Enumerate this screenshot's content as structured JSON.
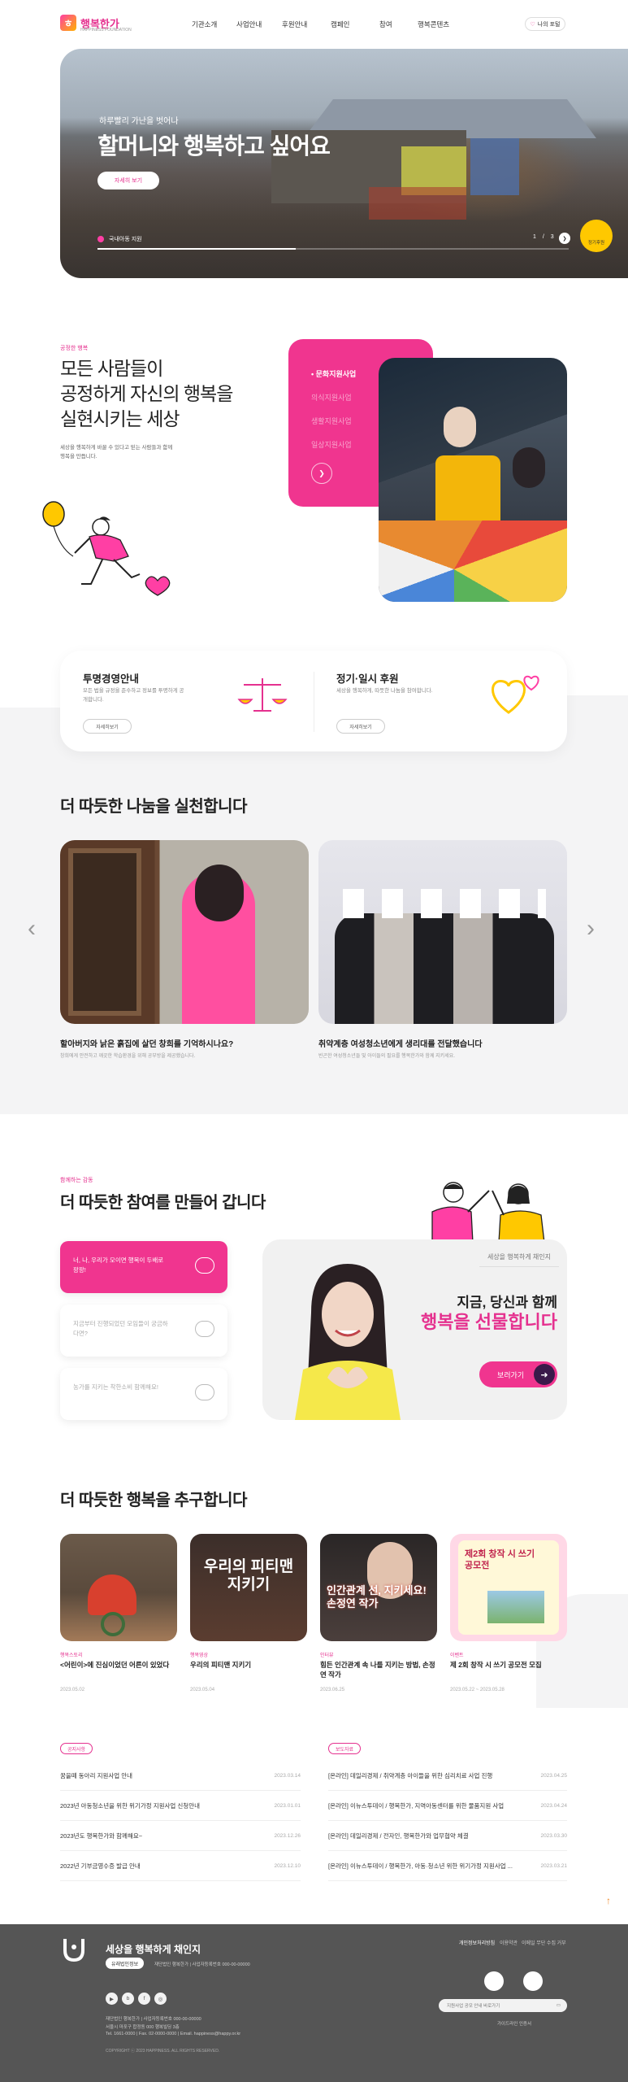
{
  "header": {
    "logo": "행복한가",
    "logo_sub": "HAPPINESS FOUNDATION",
    "nav": [
      "기관소개",
      "사업안내",
      "후원안내",
      "캠페인",
      "참여",
      "행복콘텐츠"
    ],
    "my": "나의 포털"
  },
  "hero": {
    "subtitle": "하루빨리 가난을 벗어나",
    "title": "할머니와 행복하고 싶어요",
    "button": "자세히 보기",
    "caption": "국내아동 지원",
    "pager": "1 / 3",
    "badge": "정기후원"
  },
  "mission": {
    "tag": "공정한 행복",
    "title_lines": [
      "모든 사람들이",
      "공정하게 자신의 행복을",
      "실현시키는 세상"
    ],
    "desc": "세상을 행복하게 바꿀 수 있다고 믿는 사람들과 함께 행복을 만듭니다.",
    "menu": [
      "문화지원사업",
      "의식지원사업",
      "생활지원사업",
      "일상지원사업"
    ]
  },
  "cards": [
    {
      "title": "투명경영안내",
      "desc": "모든 법을 규정을 준수하고 정보를 투명하게 공개합니다.",
      "btn": "자세히보기"
    },
    {
      "title": "정기·일시 후원",
      "desc": "세상을 행복하게, 따뜻한 나눔을 참여합니다.",
      "btn": "자세히보기"
    }
  ],
  "sharing": {
    "title": "더 따듯한 나눔을 실천합니다",
    "items": [
      {
        "title": "할아버지와 낡은 흙집에 살던 창희를 기억하시나요?",
        "desc": "창희에게 안전하고 깨끗한 학습환경을 위해 공부방을 제공했습니다."
      },
      {
        "title": "취약계층 여성청소년에게 생리대를 전달했습니다",
        "desc": "빈곤한 여성청소년들 및 아이들의 필요를 행복한가와 함께 지키세요."
      }
    ]
  },
  "participation": {
    "tag": "함께하는 감동",
    "title": "더 따듯한 참여를 만들어 갑니다",
    "items": [
      "너, 나, 우리가 모이면 행복이 두배로 팡팡!",
      "지금부터 진행되었던 모임들이 궁금하다면?",
      "농가를 지키는 착한소비 함께해요!"
    ],
    "card_top": "세상을 행복하게 채인지",
    "card_h1": "지금, 당신과 함께",
    "card_h2": "행복을 선물합니다",
    "card_btn": "보러가기"
  },
  "happiness": {
    "title": "더 따듯한 행복을 추구합니다",
    "items": [
      {
        "cat": "행복스토리",
        "title": "<어린이>에 진심이었던 어른이 있었다",
        "date": "2023.05.02"
      },
      {
        "cat": "행복영상",
        "title": "우리의 피티맨 지키기",
        "date": "2023.05.04"
      },
      {
        "cat": "인터뷰",
        "title": "힘든 인간관계 속 나를 지키는 방법, 손정연 작가",
        "date": "2023.06.25"
      },
      {
        "cat": "이벤트",
        "title": "제 2회 창작 시 쓰기 공모전 모집",
        "date": "2023.05.22 ~ 2023.05.28"
      }
    ],
    "thumb_texts": [
      "우리의 피티맨 지키기",
      "인간관계 선, 지키세요! 손정연 작가",
      "제2회 창작 시 쓰기 공모전"
    ]
  },
  "boards": {
    "left": {
      "tag": "공지사항",
      "rows": [
        {
          "t": "꿈을떼 동아리 지원사업 안내",
          "d": "2023.03.14"
        },
        {
          "t": "2023년 아동청소년을 위한 위기가정 지원사업 신청안내",
          "d": "2023.01.01"
        },
        {
          "t": "2023년도 행복한가와 함께해요~",
          "d": "2023.12.26"
        },
        {
          "t": "2022년 기부금영수증 발급 안내",
          "d": "2023.12.10"
        }
      ]
    },
    "right": {
      "tag": "보도자료",
      "rows": [
        {
          "t": "[온라인] 데일리경제 / 취약계층 아이들을 위한 심리치료 사업 진행",
          "d": "2023.04.25"
        },
        {
          "t": "[온라인] 이뉴스투데이 / 행복한가, 지역아동센터를 위한 물품지원 사업",
          "d": "2023.04.24"
        },
        {
          "t": "[온라인] 데일리경제 / 전자인, 행복한가와 업무협약 체결",
          "d": "2023.03.30"
        },
        {
          "t": "[온라인] 이뉴스투데이 / 행복한가, 아동·청소년 위한 위기가정 지원사업 ...",
          "d": "2023.03.21"
        }
      ]
    }
  },
  "footer": {
    "name": "세상을 행복하게 채인지",
    "chip": "유래법인정보",
    "addr1": "재단법인 행복한가 | 사업자등록번호 000-00-00000",
    "addr2": "서울시 마포구 합정동 000 행복빌딩 3층",
    "addr3": "Tel. 1661-0000 | Fax. 02-0000-0000 | Email. happiness@happy.or.kr",
    "copy": "COPYRIGHT ⓒ 2023 HAPPINESS. ALL RIGHTS RESERVED.",
    "links": [
      "개인정보처리방침",
      "이용약관",
      "이메일 무단 수집 거부"
    ],
    "select": "지원사업 공모 안내 바로가기",
    "auth": "가이드라인 인증서"
  }
}
